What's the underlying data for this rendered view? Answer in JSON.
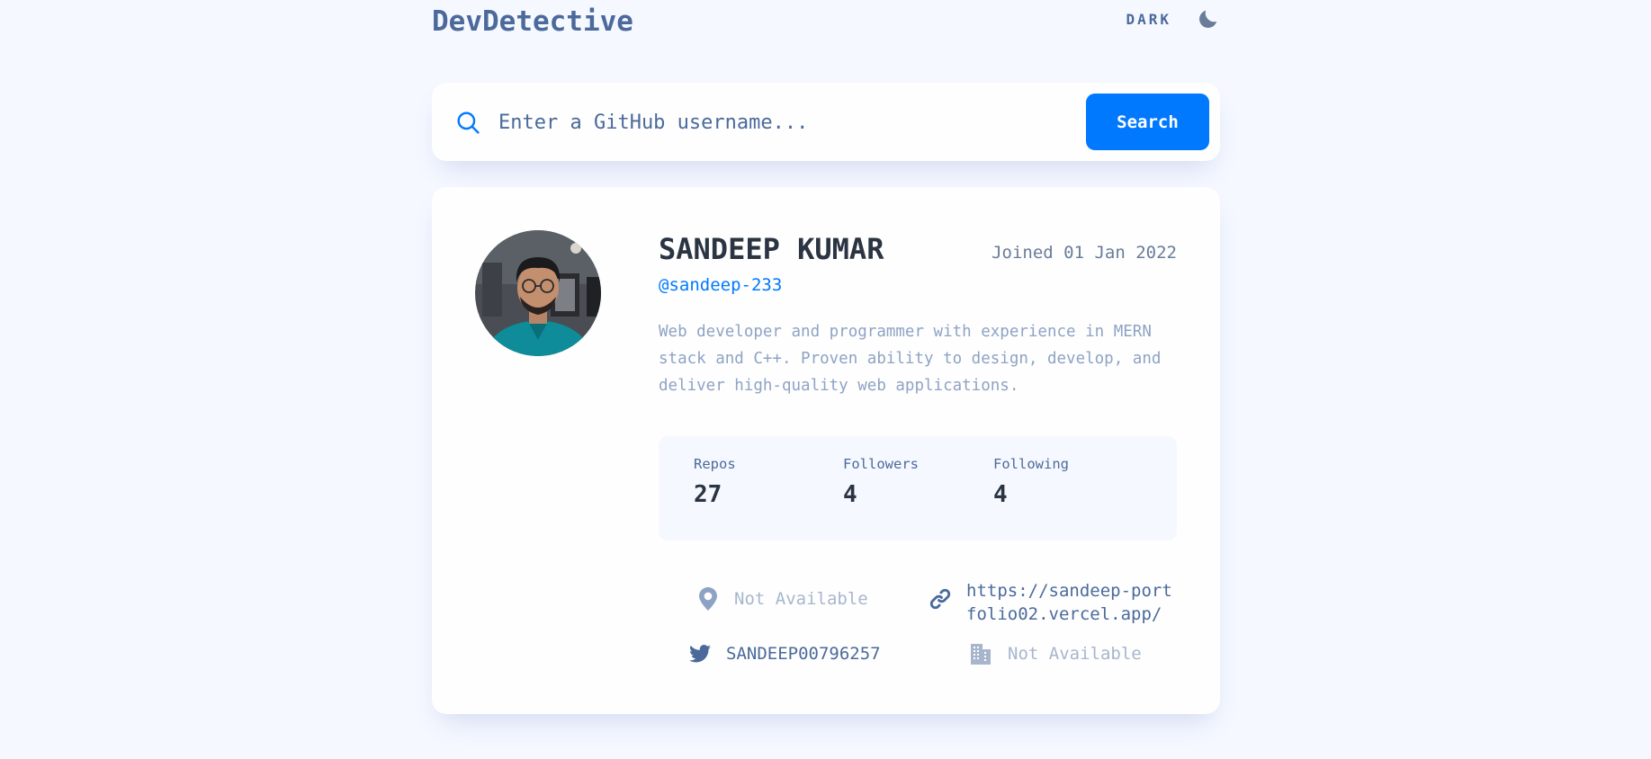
{
  "app": {
    "brand": "DevDetective",
    "theme_label": "DARK"
  },
  "search": {
    "placeholder": "Enter a GitHub username...",
    "value": "",
    "button_label": "Search"
  },
  "profile": {
    "name": "SANDEEP KUMAR",
    "joined": "Joined 01 Jan 2022",
    "handle": "@sandeep-233",
    "bio": "Web developer and programmer with experience in MERN stack and C++. Proven ability to design, develop, and deliver high-quality web applications.",
    "stats": {
      "repos_label": "Repos",
      "repos_value": "27",
      "followers_label": "Followers",
      "followers_value": "4",
      "following_label": "Following",
      "following_value": "4"
    },
    "links": {
      "location": "Not Available",
      "website": "https://sandeep-portfolio02.vercel.app/",
      "twitter": "SANDEEP00796257",
      "company": "Not Available"
    }
  },
  "icons": {
    "theme": "moon-icon",
    "search": "search-icon",
    "location": "location-pin-icon",
    "website": "link-icon",
    "twitter": "twitter-icon",
    "company": "building-icon"
  },
  "colors": {
    "accent": "#0079ff",
    "background": "#f5f8ff",
    "card": "#fefefe",
    "heading": "#2b3442",
    "text": "#4b6a9b",
    "muted": "#8ea3c4",
    "unavailable": "#a8b6cd"
  }
}
